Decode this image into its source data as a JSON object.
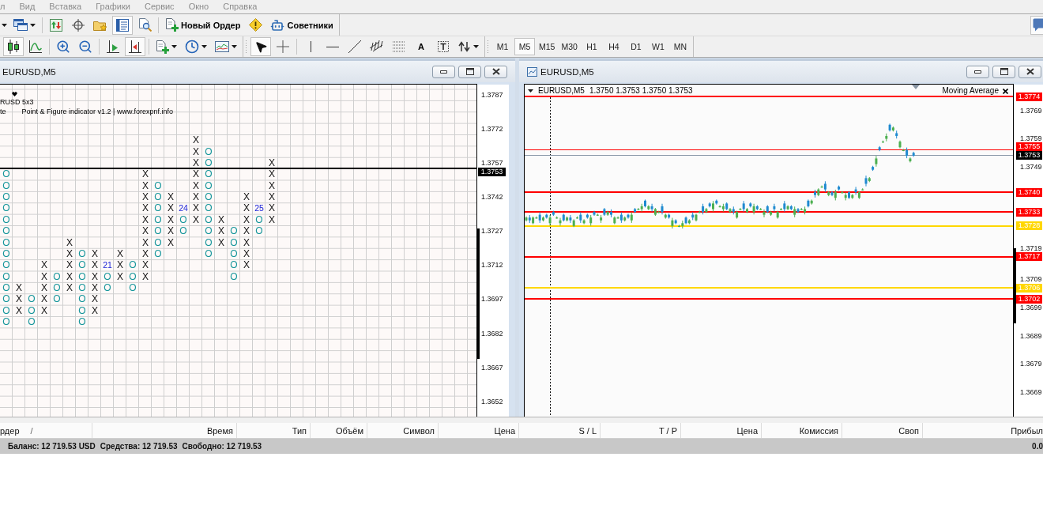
{
  "menu_bar": {
    "inactive": true,
    "items": [
      "л",
      "Вид",
      "Вставка",
      "Графики",
      "Сервис",
      "Окно",
      "Справка"
    ]
  },
  "toolbar_top": {
    "groups": [
      [
        {
          "pressed": false
        },
        {
          "pressed": false
        }
      ],
      [
        {
          "pressed": false
        },
        {
          "pressed": false
        },
        {
          "pressed": false
        },
        {
          "pressed": true
        },
        {
          "pressed": false
        }
      ],
      [
        {
          "label": "Новый Ордер",
          "pressed": false
        },
        {
          "pressed": false
        },
        {
          "label": "Советники",
          "pressed": false
        }
      ]
    ]
  },
  "toolbar_chart": {
    "groups": [
      [
        {
          "pressed": true
        },
        {
          "pressed": false
        }
      ],
      [
        {
          "pressed": false
        },
        {
          "pressed": false
        }
      ],
      [
        {
          "pressed": false
        },
        {
          "pressed": true
        }
      ],
      [
        {
          "pressed": false
        },
        {
          "pressed": false
        },
        {
          "pressed": false
        }
      ],
      [
        {
          "pressed": true
        },
        {
          "pressed": false
        }
      ],
      [
        {
          "pressed": false
        },
        {
          "pressed": false
        },
        {
          "pressed": false
        },
        {
          "pressed": false
        },
        {
          "pressed": false
        },
        {
          "label": "A",
          "pressed": false
        },
        {
          "pressed": false
        },
        {
          "pressed": false
        }
      ]
    ],
    "timeframes": [
      {
        "label": "M1",
        "selected": false
      },
      {
        "label": "M5",
        "selected": true
      },
      {
        "label": "M15",
        "selected": false
      },
      {
        "label": "M30",
        "selected": false
      },
      {
        "label": "H1",
        "selected": false
      },
      {
        "label": "H4",
        "selected": false
      },
      {
        "label": "D1",
        "selected": false
      },
      {
        "label": "W1",
        "selected": false
      },
      {
        "label": "MN",
        "selected": false
      }
    ]
  },
  "pnf_window": {
    "title": "EURUSD,M5",
    "indicator_name": "RUSD 5x3",
    "legend_prefix": "te",
    "legend": "Point & Figure indicator v1.2 | www.forexpnf.info",
    "price_axis": [
      "1.3787",
      "1.3772",
      "1.3757",
      "1.3742",
      "1.3727",
      "1.3712",
      "1.3697",
      "1.3682",
      "1.3667",
      "1.3652"
    ],
    "current_price": "1.3753",
    "rows": [
      [
        null,
        null,
        null,
        null,
        null,
        null,
        null,
        null,
        null,
        null,
        null,
        null,
        null,
        null,
        null,
        {
          "kind": "x",
          "text": "X"
        }
      ],
      [
        null,
        null,
        null,
        null,
        null,
        null,
        null,
        null,
        null,
        null,
        null,
        null,
        null,
        null,
        null,
        {
          "kind": "x",
          "text": "X"
        },
        {
          "kind": "o",
          "text": "O"
        }
      ],
      [
        null,
        null,
        null,
        null,
        null,
        null,
        null,
        null,
        null,
        null,
        null,
        null,
        null,
        null,
        null,
        {
          "kind": "x",
          "text": "X"
        },
        {
          "kind": "o",
          "text": "O"
        },
        null,
        null,
        null,
        null,
        {
          "kind": "x",
          "text": "X"
        }
      ],
      [
        {
          "kind": "o",
          "text": "O"
        },
        null,
        null,
        null,
        null,
        null,
        null,
        null,
        null,
        null,
        null,
        {
          "kind": "x",
          "text": "X"
        },
        null,
        null,
        null,
        {
          "kind": "x",
          "text": "X"
        },
        {
          "kind": "o",
          "text": "O"
        },
        null,
        null,
        null,
        null,
        {
          "kind": "x",
          "text": "X"
        }
      ],
      [
        {
          "kind": "o",
          "text": "O"
        },
        null,
        null,
        null,
        null,
        null,
        null,
        null,
        null,
        null,
        null,
        {
          "kind": "x",
          "text": "X"
        },
        {
          "kind": "o",
          "text": "O"
        },
        null,
        null,
        {
          "kind": "x",
          "text": "X"
        },
        {
          "kind": "o",
          "text": "O"
        },
        null,
        null,
        null,
        null,
        {
          "kind": "x",
          "text": "X"
        }
      ],
      [
        {
          "kind": "o",
          "text": "O"
        },
        null,
        null,
        null,
        null,
        null,
        null,
        null,
        null,
        null,
        null,
        {
          "kind": "x",
          "text": "X"
        },
        {
          "kind": "o",
          "text": "O"
        },
        {
          "kind": "x",
          "text": "X"
        },
        null,
        {
          "kind": "x",
          "text": "X"
        },
        {
          "kind": "o",
          "text": "O"
        },
        null,
        null,
        {
          "kind": "x",
          "text": "X"
        },
        null,
        {
          "kind": "x",
          "text": "X"
        }
      ],
      [
        {
          "kind": "o",
          "text": "O"
        },
        null,
        null,
        null,
        null,
        null,
        null,
        null,
        null,
        null,
        null,
        {
          "kind": "x",
          "text": "X"
        },
        {
          "kind": "o",
          "text": "O"
        },
        {
          "kind": "x",
          "text": "X"
        },
        {
          "kind": "label",
          "text": "24"
        },
        {
          "kind": "x",
          "text": "X"
        },
        {
          "kind": "o",
          "text": "O"
        },
        null,
        null,
        {
          "kind": "x",
          "text": "X"
        },
        {
          "kind": "label",
          "text": "25"
        },
        {
          "kind": "x",
          "text": "X"
        }
      ],
      [
        {
          "kind": "o",
          "text": "O"
        },
        null,
        null,
        null,
        null,
        null,
        null,
        null,
        null,
        null,
        null,
        {
          "kind": "x",
          "text": "X"
        },
        {
          "kind": "o",
          "text": "O"
        },
        {
          "kind": "x",
          "text": "X"
        },
        {
          "kind": "o",
          "text": "O"
        },
        {
          "kind": "x",
          "text": "X"
        },
        {
          "kind": "o",
          "text": "O"
        },
        {
          "kind": "x",
          "text": "X"
        },
        null,
        {
          "kind": "x",
          "text": "X"
        },
        {
          "kind": "o",
          "text": "O"
        },
        {
          "kind": "x",
          "text": "X"
        }
      ],
      [
        {
          "kind": "o",
          "text": "O"
        },
        null,
        null,
        null,
        null,
        null,
        null,
        null,
        null,
        null,
        null,
        {
          "kind": "x",
          "text": "X"
        },
        {
          "kind": "o",
          "text": "O"
        },
        {
          "kind": "x",
          "text": "X"
        },
        {
          "kind": "o",
          "text": "O"
        },
        null,
        {
          "kind": "o",
          "text": "O"
        },
        {
          "kind": "x",
          "text": "X"
        },
        {
          "kind": "o",
          "text": "O"
        },
        {
          "kind": "x",
          "text": "X"
        },
        {
          "kind": "o",
          "text": "O"
        }
      ],
      [
        {
          "kind": "o",
          "text": "O"
        },
        null,
        null,
        null,
        null,
        {
          "kind": "x",
          "text": "X"
        },
        null,
        null,
        null,
        null,
        null,
        {
          "kind": "x",
          "text": "X"
        },
        {
          "kind": "o",
          "text": "O"
        },
        {
          "kind": "x",
          "text": "X"
        },
        null,
        null,
        {
          "kind": "o",
          "text": "O"
        },
        {
          "kind": "x",
          "text": "X"
        },
        {
          "kind": "o",
          "text": "O"
        },
        {
          "kind": "x",
          "text": "X"
        }
      ],
      [
        {
          "kind": "o",
          "text": "O"
        },
        null,
        null,
        null,
        null,
        {
          "kind": "x",
          "text": "X"
        },
        {
          "kind": "o",
          "text": "O"
        },
        {
          "kind": "x",
          "text": "X"
        },
        null,
        {
          "kind": "x",
          "text": "X"
        },
        null,
        {
          "kind": "x",
          "text": "X"
        },
        {
          "kind": "o",
          "text": "O"
        },
        null,
        null,
        null,
        {
          "kind": "o",
          "text": "O"
        },
        null,
        {
          "kind": "o",
          "text": "O"
        },
        {
          "kind": "x",
          "text": "X"
        }
      ],
      [
        {
          "kind": "o",
          "text": "O"
        },
        null,
        null,
        {
          "kind": "x",
          "text": "X"
        },
        null,
        {
          "kind": "x",
          "text": "X"
        },
        {
          "kind": "o",
          "text": "O"
        },
        {
          "kind": "x",
          "text": "X"
        },
        {
          "kind": "label",
          "text": "21"
        },
        {
          "kind": "x",
          "text": "X"
        },
        {
          "kind": "o",
          "text": "O"
        },
        {
          "kind": "x",
          "text": "X"
        },
        null,
        null,
        null,
        null,
        null,
        null,
        {
          "kind": "o",
          "text": "O"
        },
        {
          "kind": "x",
          "text": "X"
        }
      ],
      [
        {
          "kind": "o",
          "text": "O"
        },
        null,
        null,
        {
          "kind": "x",
          "text": "X"
        },
        {
          "kind": "o",
          "text": "O"
        },
        {
          "kind": "x",
          "text": "X"
        },
        {
          "kind": "o",
          "text": "O"
        },
        {
          "kind": "x",
          "text": "X"
        },
        {
          "kind": "o",
          "text": "O"
        },
        {
          "kind": "x",
          "text": "X"
        },
        {
          "kind": "o",
          "text": "O"
        },
        {
          "kind": "x",
          "text": "X"
        },
        null,
        null,
        null,
        null,
        null,
        null,
        {
          "kind": "o",
          "text": "O"
        }
      ],
      [
        {
          "kind": "o",
          "text": "O"
        },
        {
          "kind": "x",
          "text": "X"
        },
        null,
        {
          "kind": "x",
          "text": "X"
        },
        {
          "kind": "o",
          "text": "O"
        },
        {
          "kind": "x",
          "text": "X"
        },
        {
          "kind": "o",
          "text": "O"
        },
        {
          "kind": "x",
          "text": "X"
        },
        {
          "kind": "o",
          "text": "O"
        },
        null,
        {
          "kind": "o",
          "text": "O"
        }
      ],
      [
        {
          "kind": "o",
          "text": "O"
        },
        {
          "kind": "x",
          "text": "X"
        },
        {
          "kind": "o",
          "text": "O"
        },
        {
          "kind": "x",
          "text": "X"
        },
        {
          "kind": "o",
          "text": "O"
        },
        null,
        {
          "kind": "o",
          "text": "O"
        },
        {
          "kind": "x",
          "text": "X"
        }
      ],
      [
        {
          "kind": "o",
          "text": "O"
        },
        {
          "kind": "x",
          "text": "X"
        },
        {
          "kind": "o",
          "text": "O"
        },
        {
          "kind": "x",
          "text": "X"
        },
        null,
        null,
        {
          "kind": "o",
          "text": "O"
        },
        {
          "kind": "x",
          "text": "X"
        }
      ],
      [
        {
          "kind": "o",
          "text": "O"
        },
        null,
        {
          "kind": "o",
          "text": "O"
        },
        null,
        null,
        null,
        {
          "kind": "o",
          "text": "O"
        }
      ]
    ]
  },
  "price_window": {
    "title": "EURUSD,M5",
    "symbol": "EURUSD,M5",
    "ohlc": "1.3750 1.3753 1.3750 1.3753",
    "indicator": "Moving Average",
    "price_axis": [
      "1.3769",
      "1.3759",
      "1.3749",
      "1.3719",
      "1.3709",
      "1.3699",
      "1.3689",
      "1.3679",
      "1.3669"
    ],
    "levels": [
      {
        "price": "1.3774",
        "color": "#ff0000",
        "kind": "thick"
      },
      {
        "price": "1.3755",
        "color": "#ff0000",
        "kind": "thin"
      },
      {
        "price": "1.3740",
        "color": "#ff0000",
        "kind": "thick"
      },
      {
        "price": "1.3733",
        "color": "#ff0000",
        "kind": "thick"
      },
      {
        "price": "1.3728",
        "color": "#ffd700",
        "kind": "thick"
      },
      {
        "price": "1.3717",
        "color": "#ff0000",
        "kind": "thick"
      },
      {
        "price": "1.3706",
        "color": "#ffd700",
        "kind": "thick"
      },
      {
        "price": "1.3702",
        "color": "#ff0000",
        "kind": "thick"
      }
    ],
    "bid": "1.3753"
  },
  "terminal": {
    "columns": [
      {
        "label": "рдер",
        "sort_marker": "/"
      },
      {
        "label": "Время"
      },
      {
        "label": "Тип"
      },
      {
        "label": "Объём"
      },
      {
        "label": "Символ"
      },
      {
        "label": "Цена"
      },
      {
        "label": "S / L"
      },
      {
        "label": "T / P"
      },
      {
        "label": "Цена"
      },
      {
        "label": "Комиссия"
      },
      {
        "label": "Своп"
      },
      {
        "label": "Прибыл"
      }
    ],
    "summary": [
      "Баланс: 12 719.53 USD",
      "Средства: 12 719.53",
      "Свободно: 12 719.53"
    ],
    "profit": "0.0"
  }
}
